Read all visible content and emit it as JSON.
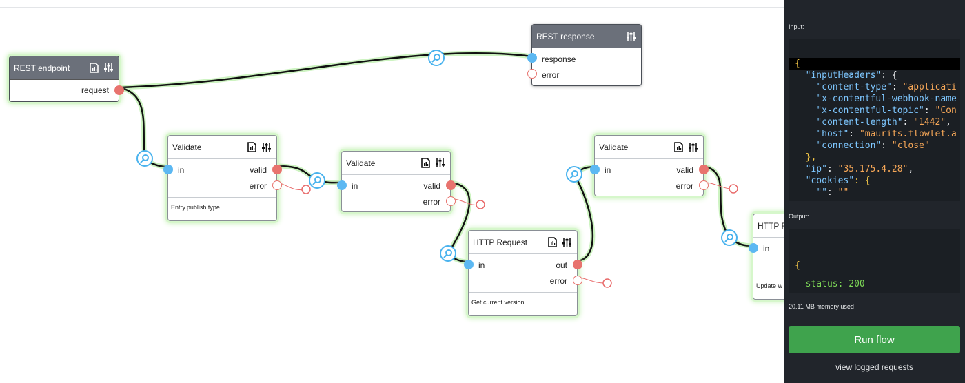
{
  "nodes": {
    "rest_endpoint": {
      "title": "REST endpoint",
      "ports": {
        "request": "request"
      }
    },
    "rest_response": {
      "title": "REST response",
      "ports": {
        "response": "response",
        "error": "error"
      }
    },
    "validate_1": {
      "title": "Validate",
      "ports": {
        "in": "in",
        "valid": "valid",
        "error": "error"
      },
      "description": "Entry.publish type"
    },
    "validate_2": {
      "title": "Validate",
      "ports": {
        "in": "in",
        "valid": "valid",
        "error": "error"
      }
    },
    "http_request_1": {
      "title": "HTTP Request",
      "ports": {
        "in": "in",
        "out": "out",
        "error": "error"
      },
      "description": "Get current version"
    },
    "validate_3": {
      "title": "Validate",
      "ports": {
        "in": "in",
        "valid": "valid",
        "error": "error"
      }
    },
    "http_request_2": {
      "title": "HTTP R",
      "ports": {
        "in": "in"
      },
      "description": "Update w"
    }
  },
  "panel": {
    "input_label": "Input:",
    "output_label": "Output:",
    "input_json": {
      "open": "{",
      "inputHeaders_key": "\"inputHeaders\"",
      "inputHeaders_open": ": {",
      "h1_key": "\"content-type\"",
      "h1_val": "\"applicati",
      "h2_key": "\"x-contentful-webhook-name",
      "h3_key": "\"x-contentful-topic\"",
      "h3_val": "\"Con",
      "h4_key": "\"content-length\"",
      "h4_val": "\"1442\"",
      "h5_key": "\"host\"",
      "h5_val": "\"maurits.flowlet.a",
      "h6_key": "\"connection\"",
      "h6_val": "\"close\"",
      "inputHeaders_close": "},",
      "ip_key": "\"ip\"",
      "ip_val": "\"35.175.4.28\"",
      "cookies_key": "\"cookies\"",
      "cookies_open": ": {",
      "c1_key": "\"\"",
      "c1_val": "\"\""
    },
    "output_json": {
      "open": "{",
      "status_key": "status",
      "status_val": "200",
      "close": "}"
    },
    "memory": "20.11 MB memory used",
    "run_button": "Run flow",
    "view_logs": "view logged requests"
  },
  "colors": {
    "input_port": "#5cb8f2",
    "output_port": "#e8736e",
    "run_button": "#3fa34d",
    "panel_bg": "#21252b",
    "node_glow": "#c4f0b4"
  }
}
